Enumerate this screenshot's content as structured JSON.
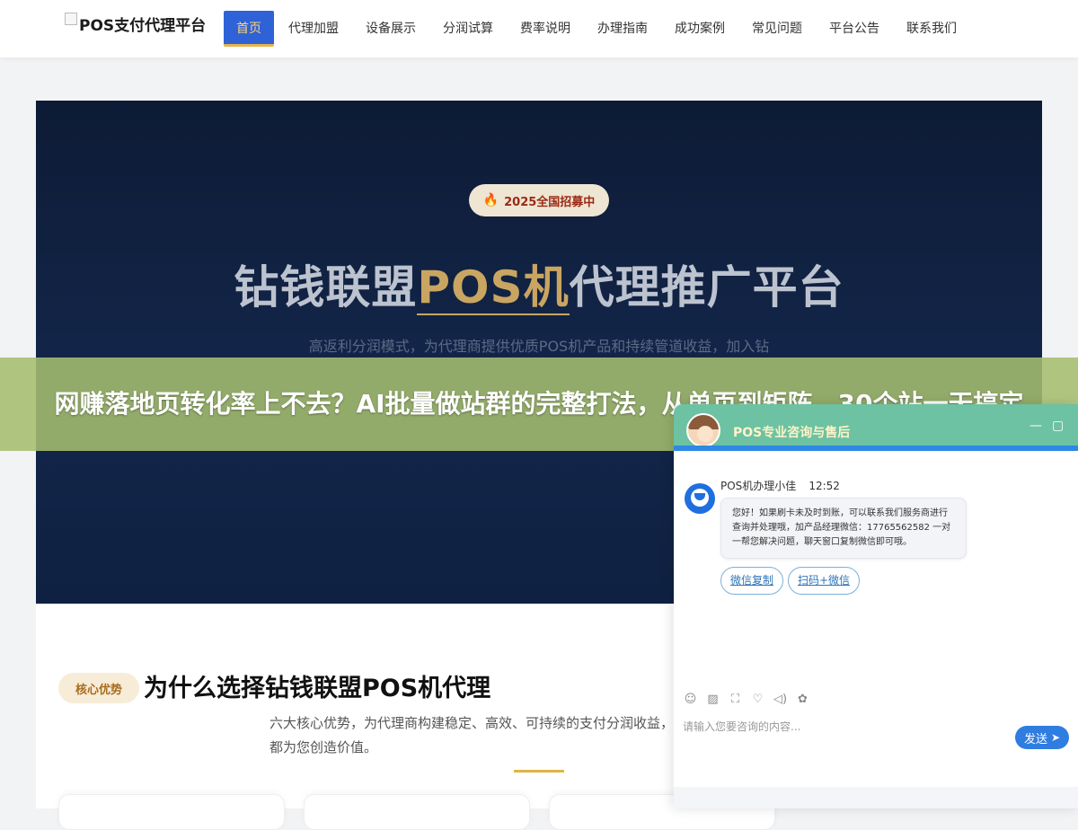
{
  "header": {
    "logo_text": "POS支付代理平台",
    "nav": [
      {
        "label": "首页",
        "active": true
      },
      {
        "label": "代理加盟"
      },
      {
        "label": "设备展示"
      },
      {
        "label": "分润试算"
      },
      {
        "label": "费率说明"
      },
      {
        "label": "办理指南"
      },
      {
        "label": "成功案例"
      },
      {
        "label": "常见问题"
      },
      {
        "label": "平台公告"
      },
      {
        "label": "联系我们"
      }
    ]
  },
  "hero": {
    "badge": "2025全国招募中",
    "title_pre": "钻钱联盟",
    "title_highlight": "POS机",
    "title_post": "代理推广平台",
    "subtitle": "高返利分润模式，为代理商提供优质POS机产品和持续管道收益，加入钻"
  },
  "overlay": {
    "text": "网赚落地页转化率上不去？AI批量做站群的完整打法，从单页到矩阵，30个站一天搞定"
  },
  "section": {
    "tag": "核心优势",
    "title": "为什么选择钻钱联盟POS机代理",
    "desc": "六大核心优势，为代理商构建稳定、高效、可持续的支付分润收益，易都为您创造价值。"
  },
  "chat": {
    "title": "POS专业咨询与售后",
    "agent_name": "POS机办理小佳",
    "time": "12:52",
    "message": "您好！如果刷卡未及时到账，可以联系我们服务商进行查询并处理哦，加产品经理微信：17765562582 一对一帮您解决问题，聊天窗口复制微信即可哦。",
    "chips": [
      "微信复制",
      "扫码+微信"
    ],
    "input_placeholder": "请输入您要咨询的内容...",
    "send_label": "发送",
    "minimize": "—",
    "maximize": "▢",
    "tools": [
      "☺",
      "▨",
      "⛶",
      "♡",
      "◁)",
      "✿"
    ],
    "tool_icons": [
      "emoji-icon",
      "image-icon",
      "screenshot-icon",
      "rating-icon",
      "voice-icon",
      "chat-bubbles-icon"
    ]
  }
}
